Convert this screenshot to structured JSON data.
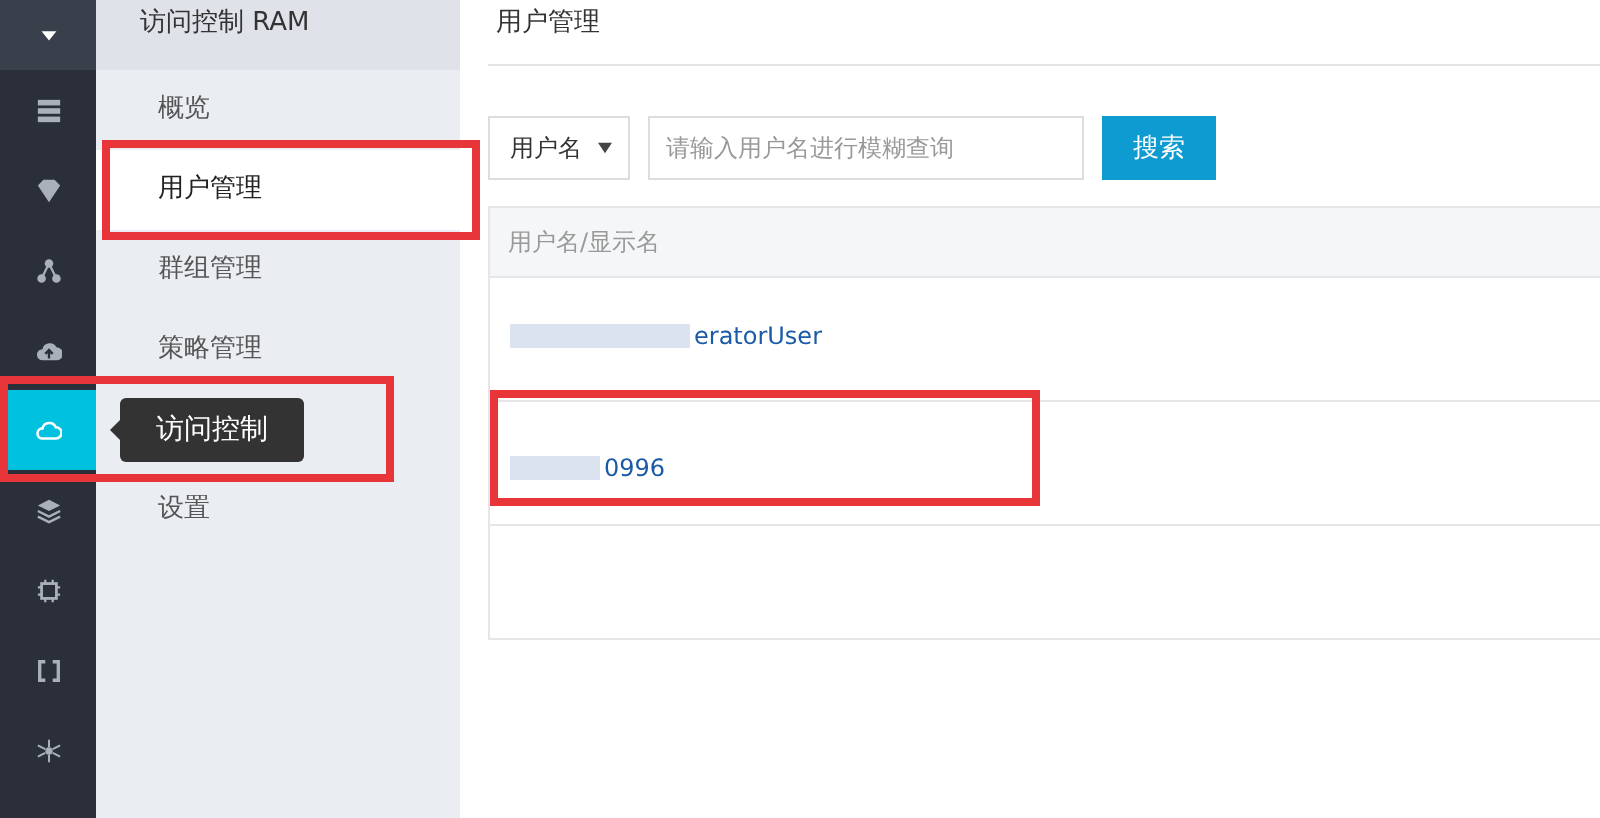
{
  "rail": {
    "items": [
      {
        "kind": "caret",
        "selected": false,
        "highlighted": false
      },
      {
        "kind": "server",
        "selected": false,
        "highlighted": false
      },
      {
        "kind": "gem",
        "selected": false,
        "highlighted": false
      },
      {
        "kind": "nodes",
        "selected": false,
        "highlighted": false
      },
      {
        "kind": "upload",
        "selected": false,
        "highlighted": false
      },
      {
        "kind": "cloud",
        "selected": true,
        "highlighted": true
      },
      {
        "kind": "layers",
        "selected": false,
        "highlighted": false
      },
      {
        "kind": "chip",
        "selected": false,
        "highlighted": false
      },
      {
        "kind": "brackets",
        "selected": false,
        "highlighted": false
      },
      {
        "kind": "network",
        "selected": false,
        "highlighted": false
      }
    ]
  },
  "tooltip": {
    "text": "访问控制"
  },
  "submenu": {
    "title": "访问控制 RAM",
    "items": [
      {
        "kind": "link",
        "label": "概览",
        "selected": false,
        "highlighted": false
      },
      {
        "kind": "link",
        "label": "用户管理",
        "selected": true,
        "highlighted": true
      },
      {
        "kind": "link",
        "label": "群组管理",
        "selected": false,
        "highlighted": false
      },
      {
        "kind": "link",
        "label": "策略管理",
        "selected": false,
        "highlighted": false
      },
      {
        "kind": "spacer"
      },
      {
        "kind": "link",
        "label": "设置",
        "selected": false,
        "highlighted": false
      }
    ]
  },
  "page": {
    "title": "用户管理"
  },
  "search": {
    "field_select": "用户名",
    "placeholder": "请输入用户名进行模糊查询",
    "button": "搜索"
  },
  "table": {
    "columns": [
      "用户名/显示名"
    ],
    "rows": [
      {
        "name": "eratorUser",
        "redacted": true,
        "highlighted": false
      },
      {
        "name": "0996",
        "redacted": true,
        "highlighted": true
      }
    ]
  }
}
